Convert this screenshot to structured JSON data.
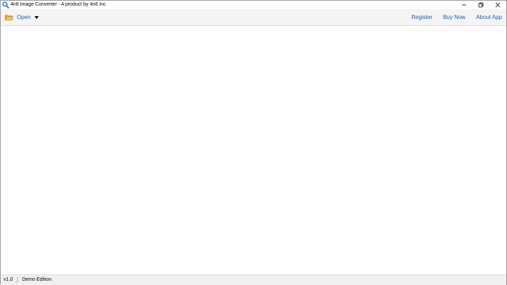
{
  "window": {
    "title": "4n6 Image Converter - A product by 4n6 Inc",
    "app_icon": "magnifier-icon",
    "controls": {
      "minimize_icon": "minimize-icon",
      "restore_icon": "restore-icon",
      "close_icon": "close-icon"
    }
  },
  "toolbar": {
    "open_label": "Open",
    "open_icon": "folder-open-icon",
    "dropdown_icon": "caret-down-icon",
    "links": {
      "register": "Register",
      "buy_now": "Buy Now",
      "about_app": "About App"
    },
    "accent_color": "#1a5fb4"
  },
  "statusbar": {
    "version": "v1.0",
    "edition": "Demo Edition"
  }
}
